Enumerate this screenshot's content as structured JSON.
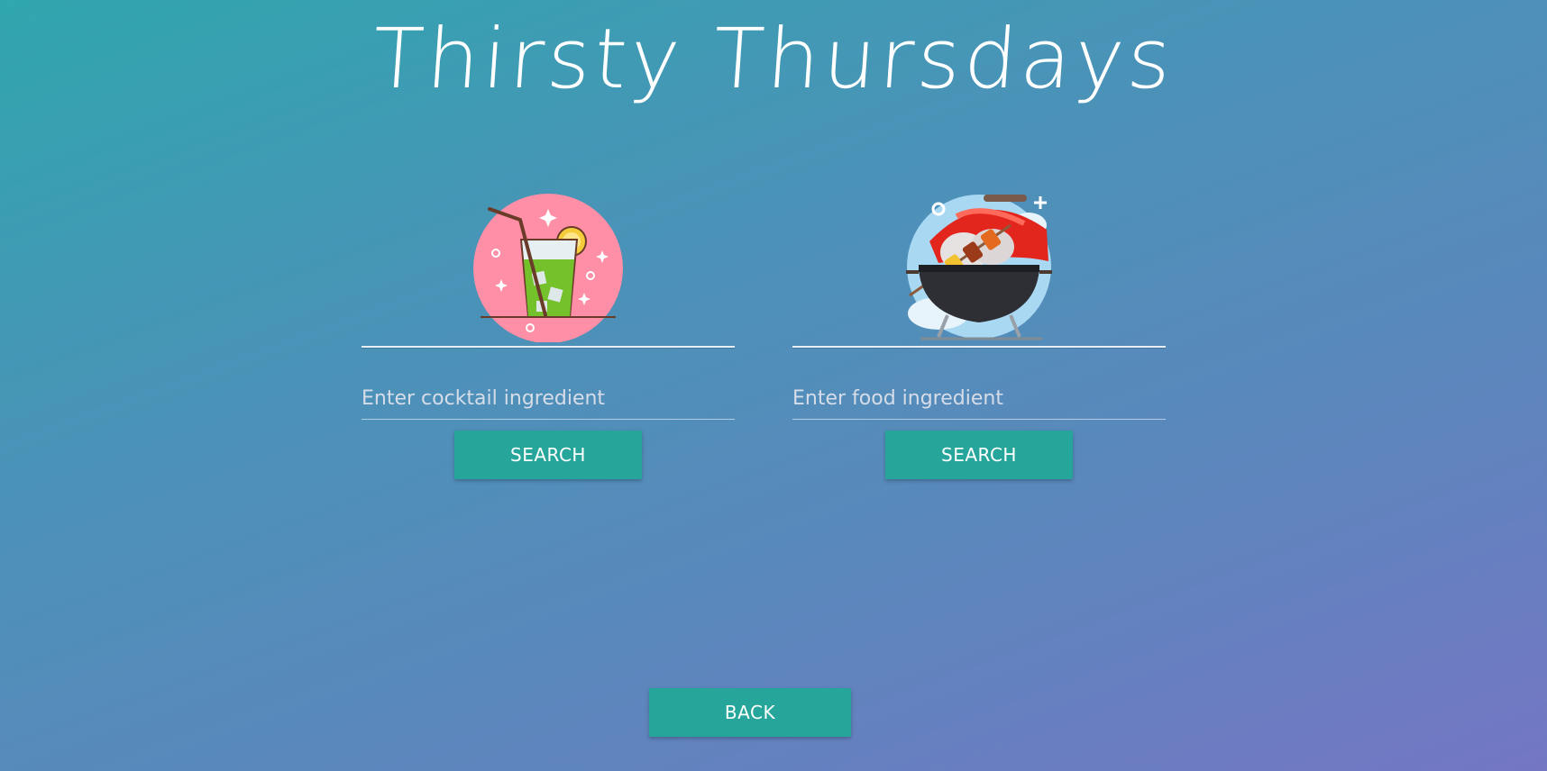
{
  "header": {
    "title": "Thirsty Thursdays"
  },
  "cocktail": {
    "icon": "cocktail-glass-icon",
    "placeholder": "Enter cocktail ingredient",
    "value": "",
    "search_label": "SEARCH"
  },
  "food": {
    "icon": "grill-bbq-icon",
    "placeholder": "Enter food ingredient",
    "value": "",
    "search_label": "SEARCH"
  },
  "footer": {
    "back_label": "BACK"
  },
  "colors": {
    "button": "#26a69a",
    "text": "#ffffff"
  }
}
